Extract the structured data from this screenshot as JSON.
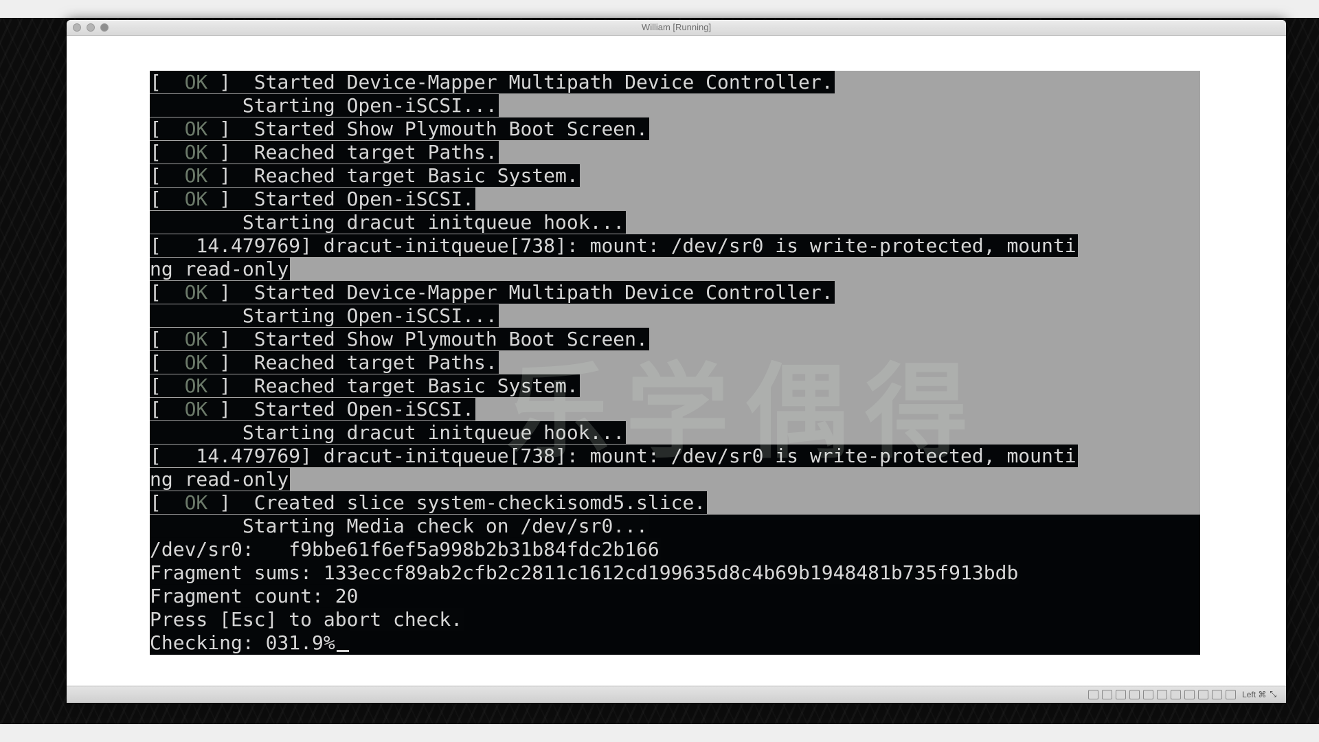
{
  "window": {
    "title": "William [Running]"
  },
  "console": {
    "lines": [
      {
        "kind": "ok",
        "text": " ]  Started Device-Mapper Multipath Device Controller.",
        "hl": true
      },
      {
        "kind": "plain",
        "text": "        Starting Open-iSCSI...",
        "hl": true
      },
      {
        "kind": "ok",
        "text": " ]  Started Show Plymouth Boot Screen.",
        "hl": true
      },
      {
        "kind": "ok",
        "text": " ]  Reached target Paths.",
        "hl": true
      },
      {
        "kind": "ok",
        "text": " ]  Reached target Basic System.",
        "hl": true
      },
      {
        "kind": "ok",
        "text": " ]  Started Open-iSCSI.",
        "hl": true
      },
      {
        "kind": "plain",
        "text": "        Starting dracut initqueue hook...",
        "hl": true
      },
      {
        "kind": "plain",
        "text": "[   14.479769] dracut-initqueue[738]: mount: /dev/sr0 is write-protected, mounti",
        "hl": true
      },
      {
        "kind": "plain",
        "text": "ng read-only",
        "hl": true
      },
      {
        "kind": "ok",
        "text": " ]  Started Device-Mapper Multipath Device Controller.",
        "hl": true
      },
      {
        "kind": "plain",
        "text": "        Starting Open-iSCSI...",
        "hl": true
      },
      {
        "kind": "ok",
        "text": " ]  Started Show Plymouth Boot Screen.",
        "hl": true
      },
      {
        "kind": "ok",
        "text": " ]  Reached target Paths.",
        "hl": true
      },
      {
        "kind": "ok",
        "text": " ]  Reached target Basic System.",
        "hl": true
      },
      {
        "kind": "ok",
        "text": " ]  Started Open-iSCSI.",
        "hl": true
      },
      {
        "kind": "plain",
        "text": "        Starting dracut initqueue hook...",
        "hl": true
      },
      {
        "kind": "plain",
        "text": "[   14.479769] dracut-initqueue[738]: mount: /dev/sr0 is write-protected, mounti",
        "hl": true
      },
      {
        "kind": "plain",
        "text": "ng read-only",
        "hl": true
      },
      {
        "kind": "ok",
        "text": " ]  Created slice system-checkisomd5.slice.",
        "hl": true
      },
      {
        "kind": "plain",
        "text": "        Starting Media check on /dev/sr0...",
        "hl": false
      },
      {
        "kind": "plain",
        "text": "/dev/sr0:   f9bbe61f6ef5a998b2b31b84fdc2b166",
        "hl": false
      },
      {
        "kind": "plain",
        "text": "Fragment sums: 133eccf89ab2cfb2c2811c1612cd199635d8c4b69b1948481b735f913bdb",
        "hl": false
      },
      {
        "kind": "plain",
        "text": "Fragment count: 20",
        "hl": false
      },
      {
        "kind": "plain",
        "text": "Press [Esc] to abort check.",
        "hl": false
      },
      {
        "kind": "cursor",
        "text": "Checking: 031.9%",
        "hl": false
      }
    ],
    "ok_prefix": "[  ",
    "ok_label": "OK"
  },
  "statusbar": {
    "host_key": "Left ⌘",
    "icons": [
      "disk-icon",
      "optical-icon",
      "audio-icon",
      "network-icon",
      "usb-icon",
      "shared-folder-icon",
      "display-icon",
      "capture-icon",
      "cpu-icon",
      "keyboard-icon",
      "mouse-icon"
    ]
  },
  "watermark": "乐学偶得"
}
